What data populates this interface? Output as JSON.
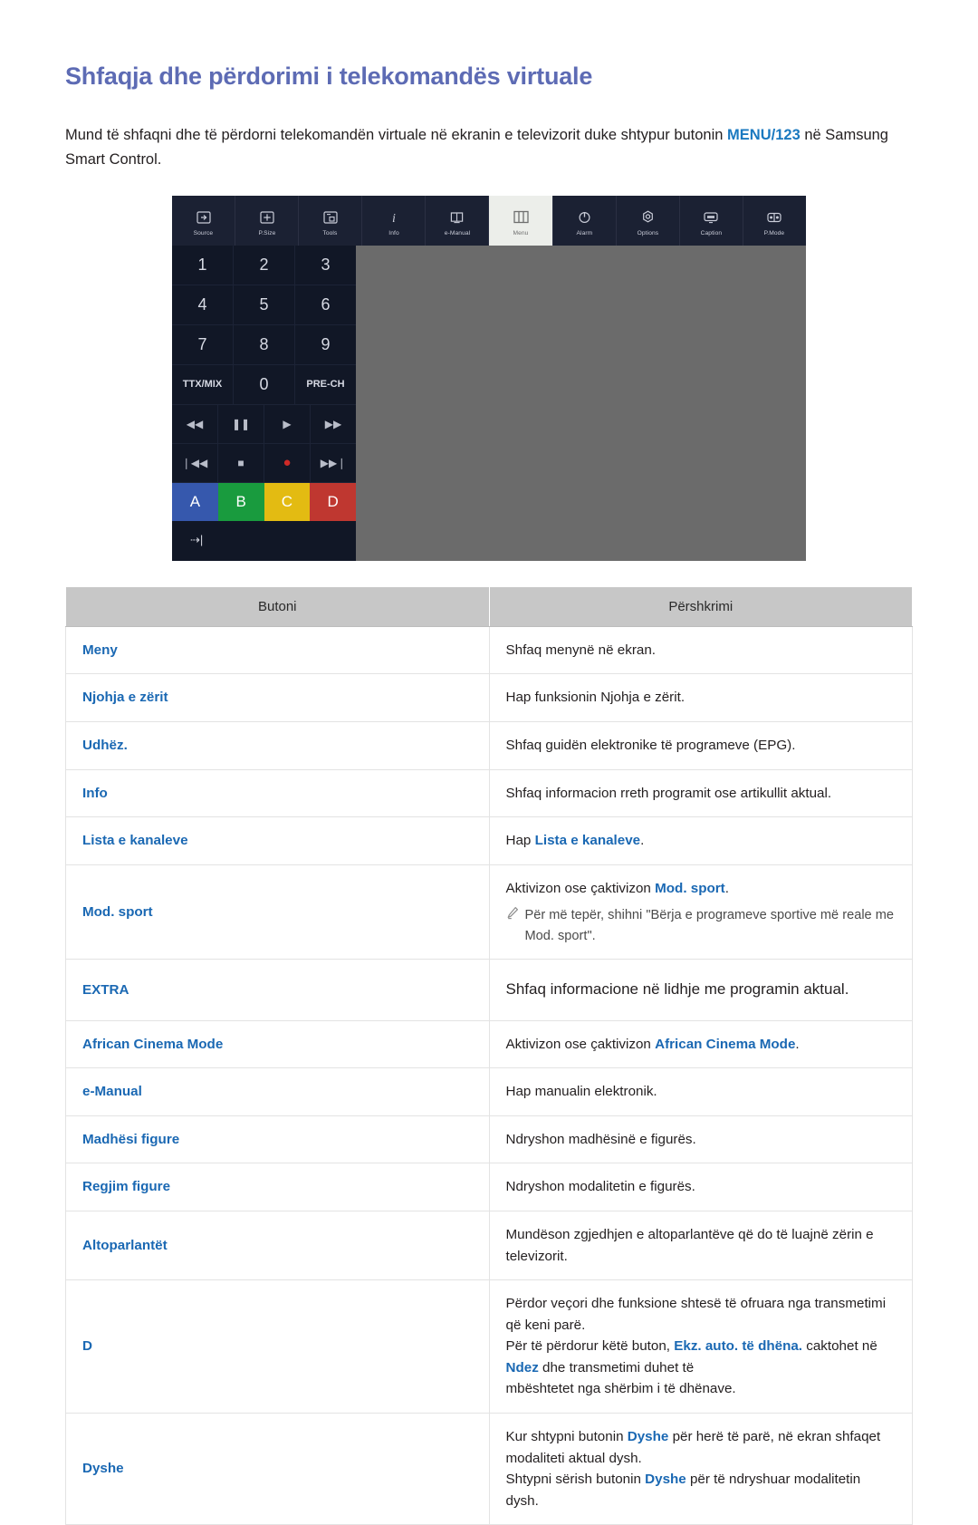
{
  "document": {
    "title": "Shfaqja dhe përdorimi i telekomandës virtuale",
    "intro_part1": "Mund të shfaqni dhe të përdorni telekomandën virtuale në ekranin e televizorit duke shtypur butonin ",
    "intro_highlight": "MENU/123",
    "intro_part2": " në Samsung Smart Control."
  },
  "remote": {
    "toolbar": [
      {
        "label": "Source",
        "icon": "source-icon",
        "active": false
      },
      {
        "label": "P.Size",
        "icon": "picture-size-icon",
        "active": false
      },
      {
        "label": "Tools",
        "icon": "tools-icon",
        "active": false
      },
      {
        "label": "Info",
        "icon": "info-icon",
        "active": false
      },
      {
        "label": "e-Manual",
        "icon": "e-manual-icon",
        "active": false
      },
      {
        "label": "Menu",
        "icon": "menu-icon",
        "active": true
      },
      {
        "label": "Alarm",
        "icon": "alarm-power-icon",
        "active": false
      },
      {
        "label": "Options",
        "icon": "options-gear-icon",
        "active": false
      },
      {
        "label": "Caption",
        "icon": "caption-icon",
        "active": false
      },
      {
        "label": "P.Mode",
        "icon": "picture-mode-icon",
        "active": false
      }
    ],
    "keypad": [
      [
        "1",
        "2",
        "3"
      ],
      [
        "4",
        "5",
        "6"
      ],
      [
        "7",
        "8",
        "9"
      ],
      [
        "TTX/MIX",
        "0",
        "PRE-CH"
      ]
    ],
    "media_rows": [
      [
        "rewind-icon",
        "pause-icon",
        "play-icon",
        "fast-forward-icon"
      ],
      [
        "skip-previous-icon",
        "stop-icon",
        "record-icon",
        "skip-next-icon"
      ]
    ],
    "media_glyphs": {
      "rewind-icon": "◀◀",
      "pause-icon": "❚❚",
      "play-icon": "▶",
      "fast-forward-icon": "▶▶",
      "skip-previous-icon": "❘◀◀",
      "stop-icon": "■",
      "record-icon": "●",
      "skip-next-icon": "▶▶❘"
    },
    "color_buttons": [
      {
        "label": "A",
        "color": "#3658ad"
      },
      {
        "label": "B",
        "color": "#199b3e"
      },
      {
        "label": "C",
        "color": "#e3bb12"
      },
      {
        "label": "D",
        "color": "#bf3730"
      }
    ],
    "bottom_button_glyph": "⇢|"
  },
  "table": {
    "headers": [
      "Butoni",
      "Përshkrimi"
    ],
    "rows": [
      {
        "button": "Meny",
        "desc_plain": "Shfaq menynë në ekran."
      },
      {
        "button": "Njohja e zërit",
        "desc_plain": "Hap funksionin Njohja e zërit."
      },
      {
        "button": "Udhëz.",
        "desc_plain": "Shfaq guidën elektronike të programeve (EPG)."
      },
      {
        "button": "Info",
        "desc_plain": "Shfaq informacion rreth programit ose artikullit aktual."
      },
      {
        "button": "Lista e kanaleve",
        "desc_pre": "Hap ",
        "desc_hl": "Lista e kanaleve",
        "desc_post": "."
      },
      {
        "button": "Mod. sport",
        "desc_pre": "Aktivizon ose çaktivizon ",
        "desc_hl": "Mod. sport",
        "desc_post": ".",
        "note": "Për më tepër, shihni \"Bërja e programeve sportive më reale me Mod. sport\"."
      },
      {
        "button": "EXTRA",
        "desc_plain": "Shfaq informacione në lidhje me programin aktual."
      },
      {
        "button": "African Cinema Mode",
        "desc_pre": "Aktivizon ose çaktivizon ",
        "desc_hl": "African Cinema Mode",
        "desc_post": "."
      },
      {
        "button": "e-Manual",
        "desc_plain": "Hap manualin elektronik."
      },
      {
        "button": "Madhësi figure",
        "desc_plain": "Ndryshon madhësinë e figurës."
      },
      {
        "button": "Regjim figure",
        "desc_plain": "Ndryshon modalitetin e figurës."
      },
      {
        "button": "Altoparlantët",
        "desc_plain": "Mundëson zgjedhjen e altoparlantëve që do të luajnë zërin e televizorit."
      },
      {
        "button": "D",
        "d_line1": "Përdor veçori dhe funksione shtesë të ofruara nga transmetimi që keni parë.",
        "d_line2_pre": "Për të përdorur këtë buton, ",
        "d_line2_hl1": "Ekz. auto. të dhëna.",
        "d_line2_mid": " caktohet në ",
        "d_line2_hl2": "Ndez",
        "d_line2_post": " dhe transmetimi duhet të",
        "d_line3": "mbështetet nga shërbim i të dhënave."
      },
      {
        "button": "Dyshe",
        "dys_line1_pre": "Kur shtypni butonin ",
        "dys_line1_hl": "Dyshe",
        "dys_line1_post": " për herë të parë, në ekran shfaqet modaliteti aktual dysh.",
        "dys_line2_pre": "Shtypni sërish butonin ",
        "dys_line2_hl": "Dyshe",
        "dys_line2_post": " për të ndryshuar modalitetin dysh."
      }
    ]
  },
  "colors": {
    "title": "#5d6bb4",
    "link_blue": "#1a68b3",
    "table_header_bg": "#c7c7c7",
    "remote_dark": "#111726",
    "remote_toolbar": "#1b2133",
    "remote_screen": "#6b6b6b"
  }
}
